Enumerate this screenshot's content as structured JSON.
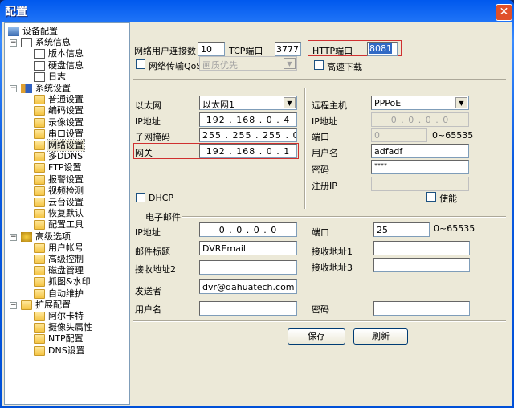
{
  "window": {
    "title": "配置",
    "close_icon": "close-icon"
  },
  "tree": [
    {
      "label": "设备配置",
      "level": 0,
      "icon": "computer"
    },
    {
      "label": "系统信息",
      "level": 1,
      "icon": "doc",
      "expand": "−"
    },
    {
      "label": "版本信息",
      "level": 2,
      "icon": "doc"
    },
    {
      "label": "硬盘信息",
      "level": 2,
      "icon": "doc"
    },
    {
      "label": "日志",
      "level": 2,
      "icon": "doc"
    },
    {
      "label": "系统设置",
      "level": 1,
      "icon": "tools",
      "expand": "−"
    },
    {
      "label": "普通设置",
      "level": 2,
      "icon": "folder"
    },
    {
      "label": "编码设置",
      "level": 2,
      "icon": "folder"
    },
    {
      "label": "录像设置",
      "level": 2,
      "icon": "folder"
    },
    {
      "label": "串口设置",
      "level": 2,
      "icon": "folder"
    },
    {
      "label": "网络设置",
      "level": 2,
      "icon": "folder",
      "selected": true
    },
    {
      "label": "多DDNS",
      "level": 2,
      "icon": "folder"
    },
    {
      "label": "FTP设置",
      "level": 2,
      "icon": "folder"
    },
    {
      "label": "报警设置",
      "level": 2,
      "icon": "folder"
    },
    {
      "label": "视频检测",
      "level": 2,
      "icon": "folder"
    },
    {
      "label": "云台设置",
      "level": 2,
      "icon": "folder"
    },
    {
      "label": "恢复默认",
      "level": 2,
      "icon": "folder"
    },
    {
      "label": "配置工具",
      "level": 2,
      "icon": "folder"
    },
    {
      "label": "高级选项",
      "level": 1,
      "icon": "gears",
      "expand": "−"
    },
    {
      "label": "用户帐号",
      "level": 2,
      "icon": "folder"
    },
    {
      "label": "高级控制",
      "level": 2,
      "icon": "folder"
    },
    {
      "label": "磁盘管理",
      "level": 2,
      "icon": "folder"
    },
    {
      "label": "抓图&水印",
      "level": 2,
      "icon": "folder"
    },
    {
      "label": "自动维护",
      "level": 2,
      "icon": "folder"
    },
    {
      "label": "扩展配置",
      "level": 1,
      "icon": "folder",
      "expand": "−"
    },
    {
      "label": "阿尔卡特",
      "level": 2,
      "icon": "folder"
    },
    {
      "label": "摄像头属性",
      "level": 2,
      "icon": "folder"
    },
    {
      "label": "NTP配置",
      "level": 2,
      "icon": "folder"
    },
    {
      "label": "DNS设置",
      "level": 2,
      "icon": "folder"
    }
  ],
  "top": {
    "max_conn_label": "网络用户连接数",
    "max_conn": "10",
    "tcp_label": "TCP端口",
    "tcp": "37777",
    "http_label": "HTTP端口",
    "http": "8081",
    "qos_label": "网络传输QoS",
    "qos_value": "画质优先",
    "fast_dl_label": "高速下载"
  },
  "lan": {
    "eth_label": "以太网",
    "eth_value": "以太网1",
    "ip_label": "IP地址",
    "ip": [
      "192",
      "168",
      "0",
      "4"
    ],
    "mask_label": "子网掩码",
    "mask": [
      "255",
      "255",
      "255",
      "0"
    ],
    "gw_label": "网关",
    "gw": [
      "192",
      "168",
      "0",
      "1"
    ],
    "dhcp_label": "DHCP"
  },
  "pppoe": {
    "host_label": "远程主机",
    "host_value": "PPPoE",
    "ip_label": "IP地址",
    "ip": [
      "0",
      "0",
      "0",
      "0"
    ],
    "port_label": "端口",
    "port": "0",
    "port_range": "0~65535",
    "user_label": "用户名",
    "user": "adfadf",
    "pwd_label": "密码",
    "pwd": "****",
    "reg_label": "注册IP",
    "reg": "",
    "enable_label": "使能"
  },
  "email": {
    "section": "电子邮件",
    "ip_label": "IP地址",
    "ip": [
      "0",
      "0",
      "0",
      "0"
    ],
    "port_label": "端口",
    "port": "25",
    "port_range": "0~65535",
    "subject_label": "邮件标题",
    "subject": "DVREmail",
    "rcv1_label": "接收地址1",
    "rcv1": "",
    "rcv2_label": "接收地址2",
    "rcv2": "",
    "rcv3_label": "接收地址3",
    "rcv3": "",
    "sender_label": "发送者",
    "sender": "dvr@dahuatech.com",
    "user_label": "用户名",
    "user": "",
    "pwd_label": "密码",
    "pwd": ""
  },
  "buttons": {
    "save": "保存",
    "refresh": "刷新"
  }
}
